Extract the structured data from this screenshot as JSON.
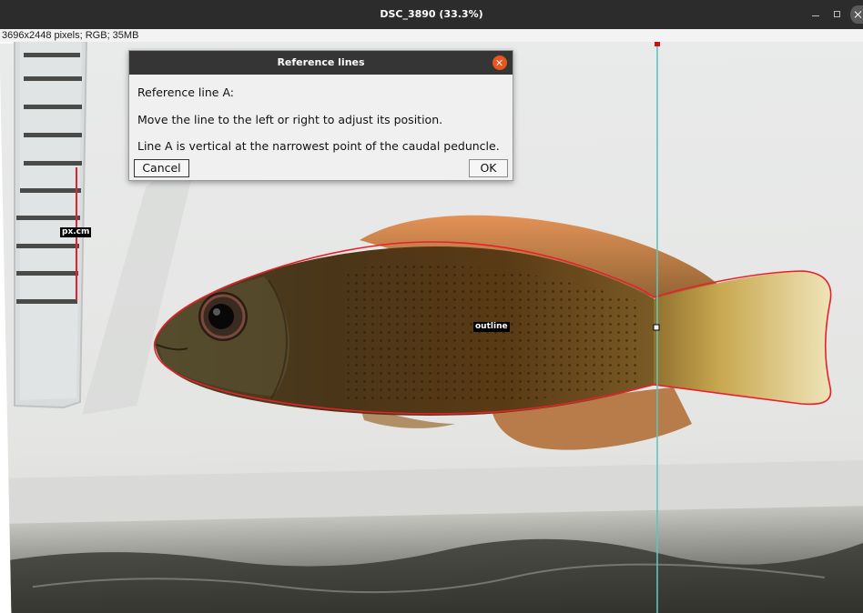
{
  "window": {
    "title": "DSC_3890 (33.3%)"
  },
  "image_info": "3696x2448 pixels; RGB; 35MB",
  "roi_labels": {
    "scale": "px.cm",
    "outline": "outline"
  },
  "dialog": {
    "title": "Reference lines",
    "line1": "Reference line A:",
    "line2": "Move the line to the left or right to adjust its position.",
    "line3": "Line A is vertical at the narrowest point of the caudal peduncle.",
    "cancel_label": "Cancel",
    "ok_label": "OK"
  },
  "colors": {
    "titlebar": "#2c2c2c",
    "outline_roi": "#e8202a",
    "reference_line": "#5fc4be",
    "dialog_close": "#e95420"
  },
  "icons": {
    "minimize": "minimize-icon",
    "maximize": "maximize-icon",
    "close": "close-icon"
  }
}
